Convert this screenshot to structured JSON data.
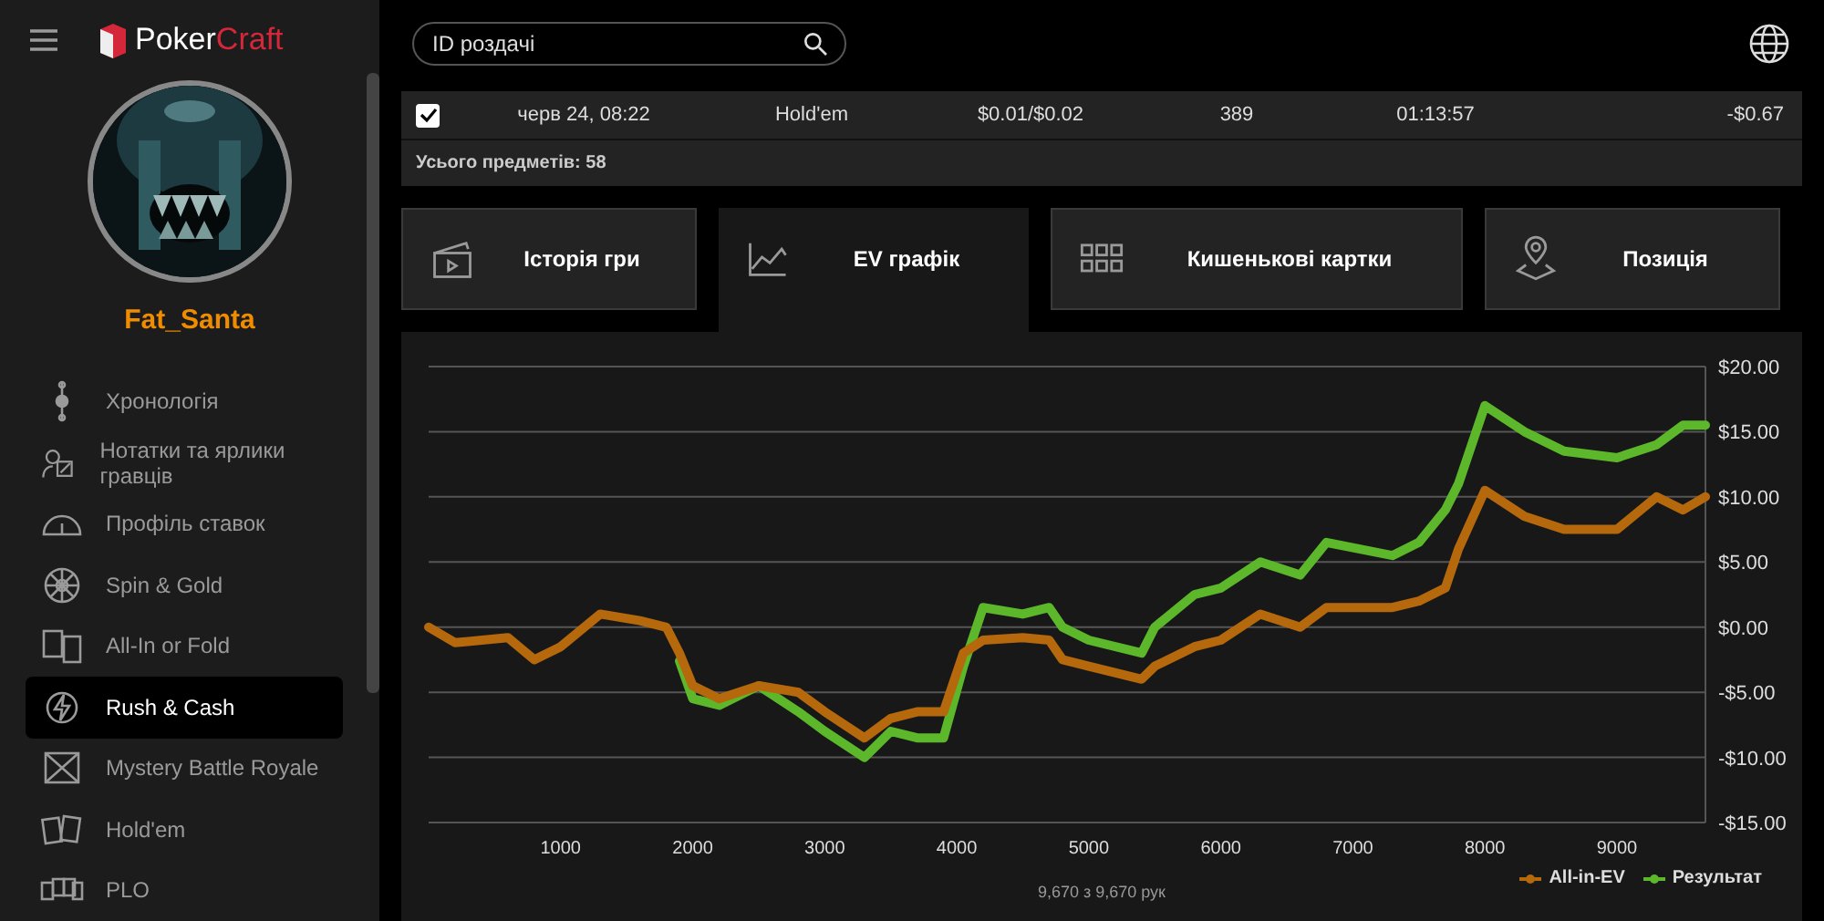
{
  "app": {
    "logo_left": "Poker",
    "logo_right": "Craft"
  },
  "user": {
    "name": "Fat_Santa"
  },
  "sidebar": {
    "items": [
      {
        "label": "Хронологія",
        "selected": false
      },
      {
        "label": "Нотатки та ярлики гравців",
        "selected": false
      },
      {
        "label": "Профіль ставок",
        "selected": false
      },
      {
        "label": "Spin & Gold",
        "selected": false
      },
      {
        "label": "All-In or Fold",
        "selected": false
      },
      {
        "label": "Rush & Cash",
        "selected": true
      },
      {
        "label": "Mystery Battle Royale",
        "selected": false
      },
      {
        "label": "Hold'em",
        "selected": false
      },
      {
        "label": "PLO",
        "selected": false
      }
    ]
  },
  "search": {
    "placeholder": "ID роздачі"
  },
  "table": {
    "rows": [
      {
        "checked": true,
        "cells": [
          "черв 24, 08:22",
          "Hold'em",
          "$0.01/$0.02",
          "389",
          "01:13:57",
          "-$0.67"
        ]
      }
    ],
    "total": "Усього предметів: 58"
  },
  "tabs": [
    {
      "label": "Історія гри",
      "selected": false
    },
    {
      "label": "EV графік",
      "selected": true
    },
    {
      "label": "Кишенькові картки",
      "selected": false
    },
    {
      "label": "Позиція",
      "selected": false
    }
  ],
  "chart": {
    "chart_data": {
      "type": "line",
      "xlim": [
        0,
        9670
      ],
      "ylim": [
        -15,
        20
      ],
      "grid": true,
      "xticks": [
        {
          "value": 1000,
          "label": "1000"
        },
        {
          "value": 2000,
          "label": "2000"
        },
        {
          "value": 3000,
          "label": "3000"
        },
        {
          "value": 4000,
          "label": "4000"
        },
        {
          "value": 5000,
          "label": "5000"
        },
        {
          "value": 6000,
          "label": "6000"
        },
        {
          "value": 7000,
          "label": "7000"
        },
        {
          "value": 8000,
          "label": "8000"
        },
        {
          "value": 9000,
          "label": "9000"
        }
      ],
      "yticks": [
        {
          "value": 20,
          "label": "$20.00"
        },
        {
          "value": 15,
          "label": "$15.00"
        },
        {
          "value": 10,
          "label": "$10.00"
        },
        {
          "value": 5,
          "label": "$5.00"
        },
        {
          "value": 0,
          "label": "$0.00"
        },
        {
          "value": -5,
          "label": "-$5.00"
        },
        {
          "value": -10,
          "label": "-$10.00"
        },
        {
          "value": -15,
          "label": "-$15.00"
        }
      ],
      "x": [
        0,
        200,
        600,
        800,
        1000,
        1300,
        1600,
        1800,
        1900,
        2000,
        2200,
        2500,
        2800,
        3000,
        3300,
        3500,
        3700,
        3900,
        4050,
        4200,
        4500,
        4700,
        4800,
        5000,
        5400,
        5500,
        5800,
        6000,
        6300,
        6600,
        6800,
        7300,
        7500,
        7700,
        7800,
        8000,
        8300,
        8600,
        9000,
        9300,
        9500,
        9670
      ],
      "series": [
        {
          "name": "All-in-EV",
          "color": "#b5690c",
          "values": [
            0,
            -1.2,
            -0.8,
            -2.5,
            -1.5,
            1,
            0.5,
            0,
            -2,
            -4.5,
            -5.5,
            -4.5,
            -5,
            -6.5,
            -8.5,
            -7,
            -6.5,
            -6.5,
            -2,
            -1,
            -0.8,
            -1,
            -2.5,
            -3,
            -4,
            -3,
            -1.5,
            -1,
            1,
            0,
            1.5,
            1.5,
            2,
            3,
            6,
            10.5,
            8.5,
            7.5,
            7.5,
            10,
            9,
            10
          ]
        },
        {
          "name": "Результат",
          "color": "#5cb82a",
          "values": [
            null,
            null,
            null,
            null,
            null,
            null,
            null,
            null,
            -2.6,
            -5.5,
            -6,
            -4.5,
            -6.5,
            -8,
            -10,
            -8,
            -8.5,
            -8.5,
            -3,
            1.5,
            1,
            1.5,
            0,
            -1,
            -2,
            0,
            2.5,
            3,
            5,
            4,
            6.5,
            5.5,
            6.5,
            9,
            11,
            17,
            15,
            13.5,
            13,
            14,
            15.5,
            15.5
          ]
        }
      ]
    },
    "count": "9,670 з 9,670 рук"
  }
}
